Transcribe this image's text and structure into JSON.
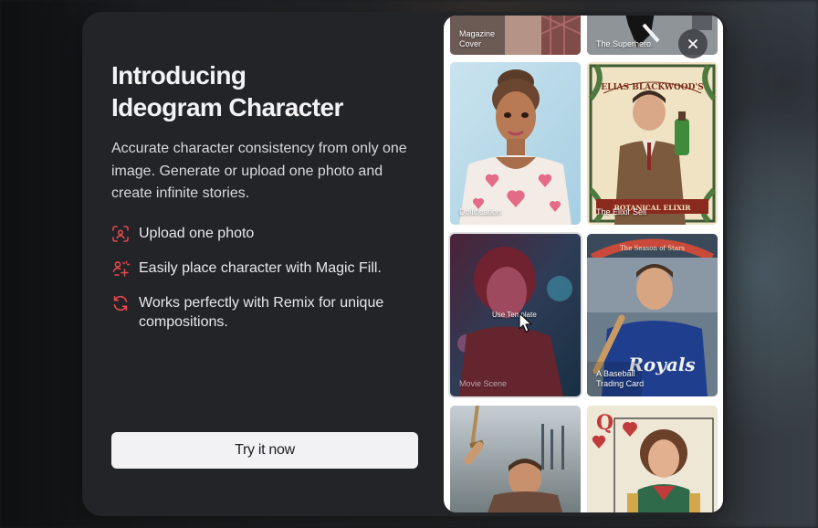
{
  "modal": {
    "title_line1": "Introducing",
    "title_line2": "Ideogram Character",
    "description": "Accurate character consistency from only one image. Generate or upload one photo and create infinite stories.",
    "features": [
      {
        "icon": "scan-face-icon",
        "text": "Upload one photo"
      },
      {
        "icon": "magic-fill-icon",
        "text": "Easily place character with Magic Fill."
      },
      {
        "icon": "remix-icon",
        "text": "Works perfectly with Remix for unique compositions."
      }
    ],
    "cta_label": "Try it now",
    "close_icon": "close-icon"
  },
  "gallery": {
    "cards": [
      {
        "label": "Magazine Cover"
      },
      {
        "label": "The Superhero"
      },
      {
        "label": "Dollification"
      },
      {
        "label": "The Elixir Sell"
      },
      {
        "label": "Movie Scene",
        "hover_text": "Use Template"
      },
      {
        "label": "A Baseball Trading Card"
      },
      {
        "label": ""
      },
      {
        "label": ""
      }
    ],
    "card_art_text": {
      "elixir_banner": "ELIAS BLACKWOOD'S",
      "elixir_bottom": "BOTANICAL ELIXIR",
      "stadium_sign": "The Season of Stars",
      "jersey_text": "Royals",
      "playing_card_rank": "Q"
    }
  },
  "colors": {
    "accent_icon": "#e5484d",
    "modal_bg": "#232427",
    "cta_bg": "#f2f2f4"
  }
}
